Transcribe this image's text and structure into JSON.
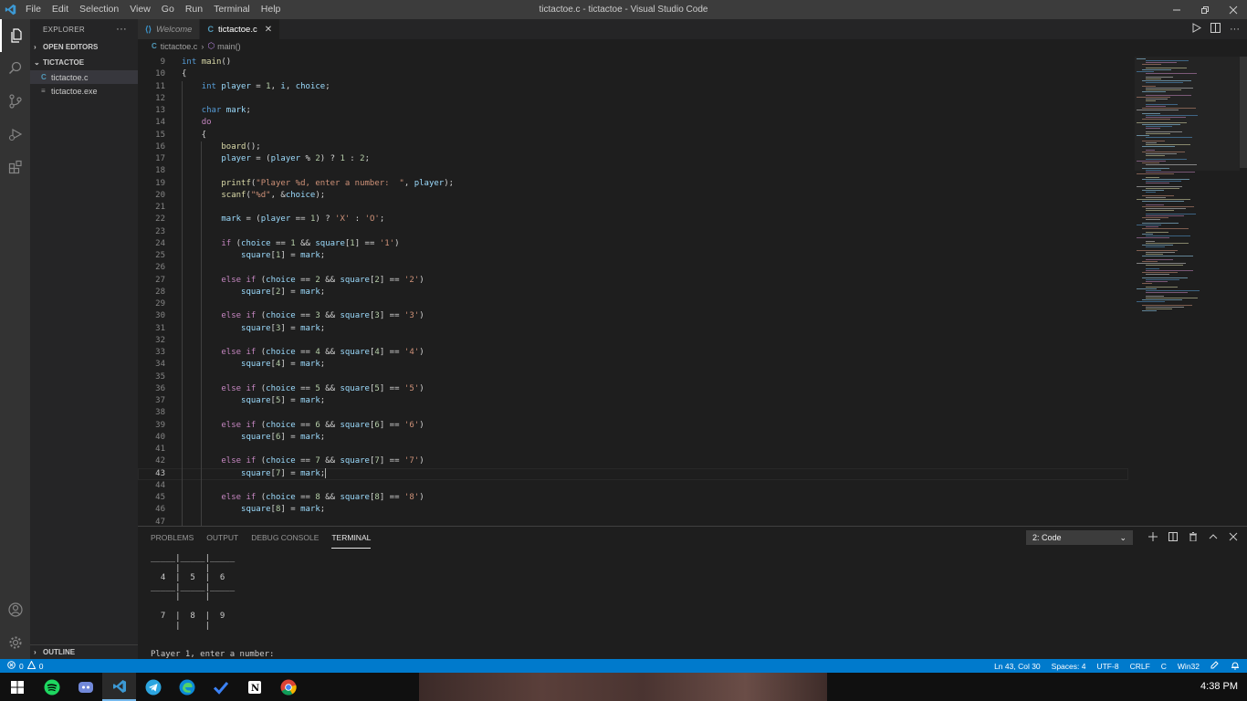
{
  "window": {
    "title": "tictactoe.c - tictactoe - Visual Studio Code"
  },
  "menu": [
    "File",
    "Edit",
    "Selection",
    "View",
    "Go",
    "Run",
    "Terminal",
    "Help"
  ],
  "sidebar": {
    "header": "EXPLORER",
    "open_editors": "OPEN EDITORS",
    "folder": "TICTACTOE",
    "files": [
      {
        "name": "tictactoe.c",
        "icon": "C",
        "selected": true
      },
      {
        "name": "tictactoe.exe",
        "icon": "≡",
        "selected": false
      }
    ],
    "outline": "OUTLINE"
  },
  "tabs": [
    {
      "label": "Welcome",
      "active": false
    },
    {
      "label": "tictactoe.c",
      "active": true
    }
  ],
  "breadcrumb": {
    "file": "tictactoe.c",
    "symbol": "main()"
  },
  "code_lines": [
    {
      "n": 9,
      "html": "<span class=\"kw\">int</span> <span class=\"fn\">main</span>()"
    },
    {
      "n": 10,
      "html": "{"
    },
    {
      "n": 11,
      "html": "    <span class=\"kw\">int</span> <span class=\"var\">player</span> = <span class=\"num\">1</span>, <span class=\"var\">i</span>, <span class=\"var\">choice</span>;"
    },
    {
      "n": 12,
      "html": ""
    },
    {
      "n": 13,
      "html": "    <span class=\"kw\">char</span> <span class=\"var\">mark</span>;"
    },
    {
      "n": 14,
      "html": "    <span class=\"kc\">do</span>"
    },
    {
      "n": 15,
      "html": "    {"
    },
    {
      "n": 16,
      "html": "        <span class=\"fn\">board</span>();"
    },
    {
      "n": 17,
      "html": "        <span class=\"var\">player</span> = (<span class=\"var\">player</span> % <span class=\"num\">2</span>) ? <span class=\"num\">1</span> : <span class=\"num\">2</span>;"
    },
    {
      "n": 18,
      "html": ""
    },
    {
      "n": 19,
      "html": "        <span class=\"fn\">printf</span>(<span class=\"str\">\"Player %d, enter a number:  \"</span>, <span class=\"var\">player</span>);"
    },
    {
      "n": 20,
      "html": "        <span class=\"fn\">scanf</span>(<span class=\"str\">\"%d\"</span>, &amp;<span class=\"var\">choice</span>);"
    },
    {
      "n": 21,
      "html": ""
    },
    {
      "n": 22,
      "html": "        <span class=\"var\">mark</span> = (<span class=\"var\">player</span> == <span class=\"num\">1</span>) ? <span class=\"str\">'X'</span> : <span class=\"str\">'O'</span>;"
    },
    {
      "n": 23,
      "html": ""
    },
    {
      "n": 24,
      "html": "        <span class=\"kc\">if</span> (<span class=\"var\">choice</span> == <span class=\"num\">1</span> &amp;&amp; <span class=\"var\">square</span>[<span class=\"num\">1</span>] == <span class=\"str\">'1'</span>)"
    },
    {
      "n": 25,
      "html": "            <span class=\"var\">square</span>[<span class=\"num\">1</span>] = <span class=\"var\">mark</span>;"
    },
    {
      "n": 26,
      "html": ""
    },
    {
      "n": 27,
      "html": "        <span class=\"kc\">else</span> <span class=\"kc\">if</span> (<span class=\"var\">choice</span> == <span class=\"num\">2</span> &amp;&amp; <span class=\"var\">square</span>[<span class=\"num\">2</span>] == <span class=\"str\">'2'</span>)"
    },
    {
      "n": 28,
      "html": "            <span class=\"var\">square</span>[<span class=\"num\">2</span>] = <span class=\"var\">mark</span>;"
    },
    {
      "n": 29,
      "html": ""
    },
    {
      "n": 30,
      "html": "        <span class=\"kc\">else</span> <span class=\"kc\">if</span> (<span class=\"var\">choice</span> == <span class=\"num\">3</span> &amp;&amp; <span class=\"var\">square</span>[<span class=\"num\">3</span>] == <span class=\"str\">'3'</span>)"
    },
    {
      "n": 31,
      "html": "            <span class=\"var\">square</span>[<span class=\"num\">3</span>] = <span class=\"var\">mark</span>;"
    },
    {
      "n": 32,
      "html": ""
    },
    {
      "n": 33,
      "html": "        <span class=\"kc\">else</span> <span class=\"kc\">if</span> (<span class=\"var\">choice</span> == <span class=\"num\">4</span> &amp;&amp; <span class=\"var\">square</span>[<span class=\"num\">4</span>] == <span class=\"str\">'4'</span>)"
    },
    {
      "n": 34,
      "html": "            <span class=\"var\">square</span>[<span class=\"num\">4</span>] = <span class=\"var\">mark</span>;"
    },
    {
      "n": 35,
      "html": ""
    },
    {
      "n": 36,
      "html": "        <span class=\"kc\">else</span> <span class=\"kc\">if</span> (<span class=\"var\">choice</span> == <span class=\"num\">5</span> &amp;&amp; <span class=\"var\">square</span>[<span class=\"num\">5</span>] == <span class=\"str\">'5'</span>)"
    },
    {
      "n": 37,
      "html": "            <span class=\"var\">square</span>[<span class=\"num\">5</span>] = <span class=\"var\">mark</span>;"
    },
    {
      "n": 38,
      "html": ""
    },
    {
      "n": 39,
      "html": "        <span class=\"kc\">else</span> <span class=\"kc\">if</span> (<span class=\"var\">choice</span> == <span class=\"num\">6</span> &amp;&amp; <span class=\"var\">square</span>[<span class=\"num\">6</span>] == <span class=\"str\">'6'</span>)"
    },
    {
      "n": 40,
      "html": "            <span class=\"var\">square</span>[<span class=\"num\">6</span>] = <span class=\"var\">mark</span>;"
    },
    {
      "n": 41,
      "html": ""
    },
    {
      "n": 42,
      "html": "        <span class=\"kc\">else</span> <span class=\"kc\">if</span> (<span class=\"var\">choice</span> == <span class=\"num\">7</span> &amp;&amp; <span class=\"var\">square</span>[<span class=\"num\">7</span>] == <span class=\"str\">'7'</span>)"
    },
    {
      "n": 43,
      "html": "            <span class=\"var\">square</span>[<span class=\"num\">7</span>] = <span class=\"var\">mark</span>;<span class=\"cursor\"></span>",
      "current": true
    },
    {
      "n": 44,
      "html": ""
    },
    {
      "n": 45,
      "html": "        <span class=\"kc\">else</span> <span class=\"kc\">if</span> (<span class=\"var\">choice</span> == <span class=\"num\">8</span> &amp;&amp; <span class=\"var\">square</span>[<span class=\"num\">8</span>] == <span class=\"str\">'8'</span>)"
    },
    {
      "n": 46,
      "html": "            <span class=\"var\">square</span>[<span class=\"num\">8</span>] = <span class=\"var\">mark</span>;"
    },
    {
      "n": 47,
      "html": ""
    }
  ],
  "panel": {
    "tabs": [
      "PROBLEMS",
      "OUTPUT",
      "DEBUG CONSOLE",
      "TERMINAL"
    ],
    "active_tab": "TERMINAL",
    "terminal_select": "2: Code",
    "terminal_lines": [
      "_____|_____|_____",
      "     |     |",
      "  4  |  5  |  6",
      "_____|_____|_____",
      "     |     |",
      "",
      "  7  |  8  |  9",
      "     |     |",
      "",
      "",
      "Player 1, enter a number:"
    ]
  },
  "status": {
    "errors": "0",
    "warnings": "0",
    "position": "Ln 43, Col 30",
    "spaces": "Spaces: 4",
    "encoding": "UTF-8",
    "eol": "CRLF",
    "language": "C",
    "platform": "Win32"
  },
  "taskbar": {
    "clock": "4:38 PM"
  },
  "colors": {
    "accent": "#007acc",
    "editor_bg": "#1e1e1e",
    "sidebar_bg": "#252526"
  }
}
